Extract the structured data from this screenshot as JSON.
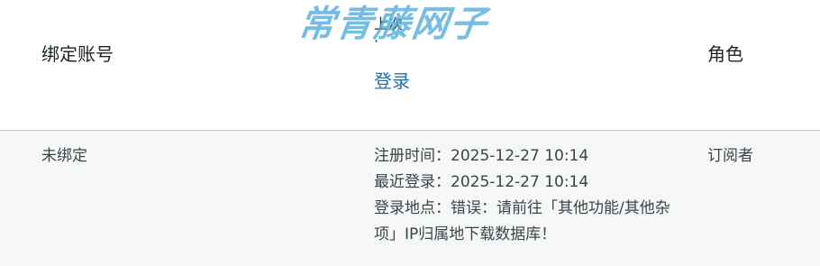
{
  "header": {
    "account_label": "绑定账号",
    "login_heading": "上次",
    "login_dot": "·",
    "login_link": "登录",
    "role_label": "角色"
  },
  "watermark": {
    "text": "常青藤网子"
  },
  "row": {
    "account": "未绑定",
    "registered": "注册时间：2025-12-27 10:14",
    "last_login": "最近登录：2025-12-27 10:14",
    "location": "登录地点：错误：请前往「其他功能/其他杂项」IP归属地下载数据库！",
    "role": "订阅者"
  }
}
